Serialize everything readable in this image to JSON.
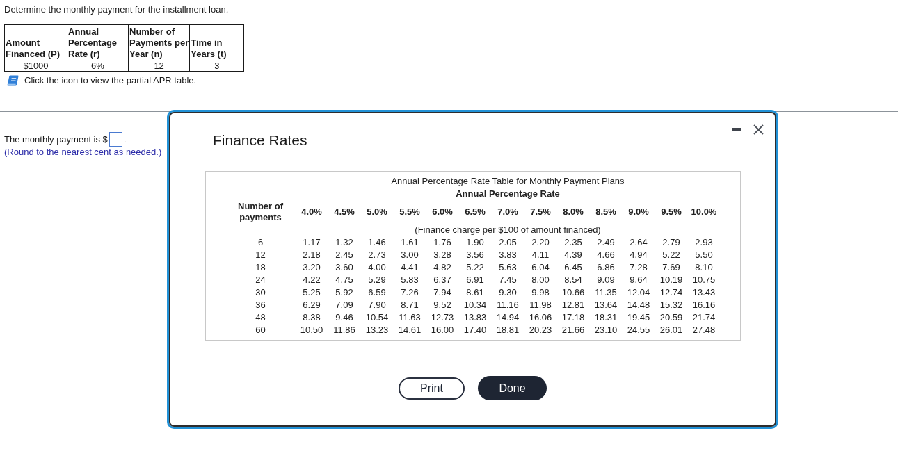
{
  "question": "Determine the monthly payment for the installment loan.",
  "loan_table": {
    "columns": [
      {
        "lines": [
          "Amount",
          "Financed (P)"
        ]
      },
      {
        "lines": [
          "Annual",
          "Percentage",
          "Rate (r)"
        ]
      },
      {
        "lines": [
          "Number of",
          "Payments per",
          "Year (n)"
        ]
      },
      {
        "lines": [
          "Time in",
          "Years (t)"
        ]
      }
    ],
    "row": [
      "$1000",
      "6%",
      "12",
      "3"
    ]
  },
  "apr_instruction": "Click the icon to view the partial APR table.",
  "answer": {
    "prefix": "The monthly payment is $",
    "suffix": ".",
    "hint": "(Round to the nearest cent as needed.)"
  },
  "dialog": {
    "title": "Finance Rates",
    "table": {
      "title": "Annual Percentage Rate Table for Monthly Payment Plans",
      "subtitle": "Annual Percentage Rate",
      "row_header": "Number of payments",
      "rates": [
        "4.0%",
        "4.5%",
        "5.0%",
        "5.5%",
        "6.0%",
        "6.5%",
        "7.0%",
        "7.5%",
        "8.0%",
        "8.5%",
        "9.0%",
        "9.5%",
        "10.0%"
      ],
      "note": "(Finance charge per $100 of amount financed)",
      "rows": [
        {
          "payments": "6",
          "values": [
            "1.17",
            "1.32",
            "1.46",
            "1.61",
            "1.76",
            "1.90",
            "2.05",
            "2.20",
            "2.35",
            "2.49",
            "2.64",
            "2.79",
            "2.93"
          ]
        },
        {
          "payments": "12",
          "values": [
            "2.18",
            "2.45",
            "2.73",
            "3.00",
            "3.28",
            "3.56",
            "3.83",
            "4.11",
            "4.39",
            "4.66",
            "4.94",
            "5.22",
            "5.50"
          ]
        },
        {
          "payments": "18",
          "values": [
            "3.20",
            "3.60",
            "4.00",
            "4.41",
            "4.82",
            "5.22",
            "5.63",
            "6.04",
            "6.45",
            "6.86",
            "7.28",
            "7.69",
            "8.10"
          ]
        },
        {
          "payments": "24",
          "values": [
            "4.22",
            "4.75",
            "5.29",
            "5.83",
            "6.37",
            "6.91",
            "7.45",
            "8.00",
            "8.54",
            "9.09",
            "9.64",
            "10.19",
            "10.75"
          ]
        },
        {
          "payments": "30",
          "values": [
            "5.25",
            "5.92",
            "6.59",
            "7.26",
            "7.94",
            "8.61",
            "9.30",
            "9.98",
            "10.66",
            "11.35",
            "12.04",
            "12.74",
            "13.43"
          ]
        },
        {
          "payments": "36",
          "values": [
            "6.29",
            "7.09",
            "7.90",
            "8.71",
            "9.52",
            "10.34",
            "11.16",
            "11.98",
            "12.81",
            "13.64",
            "14.48",
            "15.32",
            "16.16"
          ]
        },
        {
          "payments": "48",
          "values": [
            "8.38",
            "9.46",
            "10.54",
            "11.63",
            "12.73",
            "13.83",
            "14.94",
            "16.06",
            "17.18",
            "18.31",
            "19.45",
            "20.59",
            "21.74"
          ]
        },
        {
          "payments": "60",
          "values": [
            "10.50",
            "11.86",
            "13.23",
            "14.61",
            "16.00",
            "17.40",
            "18.81",
            "20.23",
            "21.66",
            "23.10",
            "24.55",
            "26.01",
            "27.48"
          ]
        }
      ]
    },
    "buttons": [
      {
        "label": "Print",
        "kind": "outline"
      },
      {
        "label": "Done",
        "kind": "primary"
      }
    ]
  }
}
